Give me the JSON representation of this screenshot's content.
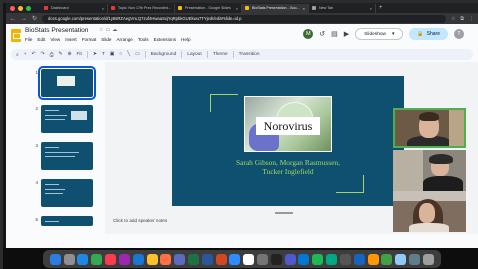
{
  "browser": {
    "tabs": [
      {
        "label": "Dashboard",
        "active": false,
        "color": "#e53935"
      },
      {
        "label": "Topic: Non 17th Prez Recorded...",
        "active": false,
        "color": "#e53935"
      },
      {
        "label": "Presentation - Google Slides",
        "active": false,
        "color": "#fbbc04"
      },
      {
        "label": "BioStats Presentation - Goo...",
        "active": true,
        "color": "#fbbc04"
      },
      {
        "label": "New Tab",
        "active": false,
        "color": "#9aa0a6"
      }
    ],
    "url": "docs.google.com/presentation/d/1y8sRZAegVnLQ7zuf4HwaaSxjYqRpbkGUEkwu7TYjedt/edit#slide=id.p"
  },
  "docs": {
    "title": "BioStats Presentation",
    "menus": [
      "File",
      "Edit",
      "View",
      "Insert",
      "Format",
      "Slide",
      "Arrange",
      "Tools",
      "Extensions",
      "Help"
    ],
    "user_initial": "M",
    "slideshow_label": "Slideshow",
    "share_label": "Share",
    "account_initial": "T",
    "toolbar": {
      "zoom": "Fit",
      "background": "Background",
      "layout": "Layout",
      "theme": "Theme",
      "transition": "Transition"
    }
  },
  "filmstrip": {
    "slides": [
      {
        "num": "1",
        "selected": true
      },
      {
        "num": "2",
        "selected": false
      },
      {
        "num": "3",
        "selected": false
      },
      {
        "num": "4",
        "selected": false
      },
      {
        "num": "5",
        "selected": false
      }
    ]
  },
  "slide": {
    "title": "Norovirus",
    "authors_line1": "Sarah Gibson, Morgan Rasmussen,",
    "authors_line2": "Tucker Inglefield",
    "bg_color": "#0f5071",
    "accent_color": "#a4d65e"
  },
  "speaker_notes_placeholder": "Click to add speaker notes",
  "dock_apps": [
    "Finder",
    "Launchpad",
    "Safari",
    "Chrome",
    "Music",
    "Podcasts",
    "App Store",
    "Notes",
    "Photos",
    "Preview",
    "Excel",
    "Word",
    "PowerPoint",
    "Zoom",
    "Calendar",
    "Settings",
    "Terminal",
    "Teams",
    "VS Code",
    "Spotify",
    "Chat",
    "Other",
    "Keynote",
    "Pages",
    "Numbers",
    "Files",
    "Downloads",
    "Trash"
  ]
}
